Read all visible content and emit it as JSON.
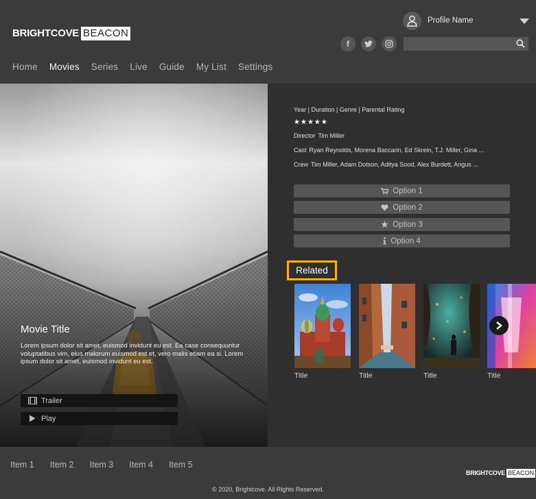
{
  "brand": {
    "name_bold": "BRIGHTCOVE",
    "name_box": "BEACON"
  },
  "profile": {
    "name": "Profile Name"
  },
  "social": [
    {
      "icon": "facebook-icon",
      "glyph": "f"
    },
    {
      "icon": "twitter-icon",
      "glyph": "t"
    },
    {
      "icon": "instagram-icon",
      "glyph": "◎"
    }
  ],
  "search": {
    "placeholder": ""
  },
  "nav": [
    {
      "label": "Home",
      "active": false
    },
    {
      "label": "Movies",
      "active": true
    },
    {
      "label": "Series",
      "active": false
    },
    {
      "label": "Live",
      "active": false
    },
    {
      "label": "Guide",
      "active": false
    },
    {
      "label": "My List",
      "active": false
    },
    {
      "label": "Settings",
      "active": false
    }
  ],
  "hero": {
    "title": "Movie Title",
    "description": "Lorem ipsum dolor sit amet, euismod invidunt eu est. Ea case consequuntur voluptatibus vim, eius malorum euismod est et, vero malis etiam ea si. Lorem ipsum dolor sit amet, euismod invidunt eu est.",
    "trailer_label": "Trailer",
    "play_label": "Play"
  },
  "details": {
    "meta": "Year | Duration | Genre | Parental Rating",
    "rating_stars": 5,
    "director_key": "Director",
    "director": "Tim Miller",
    "cast_key": "Cast",
    "cast": "Ryan Reynolds, Morena Baccarin, Ed Skrein, T.J. Miller, Gina ...",
    "crew_key": "Crew",
    "crew": "Tim Miller, Adam Dotson, Aditya Sood, Alex Burdett, Angus ..."
  },
  "options": [
    {
      "label": "Option 1",
      "icon": "cart-icon"
    },
    {
      "label": "Option 2",
      "icon": "heart-icon"
    },
    {
      "label": "Option 3",
      "icon": "star-icon"
    },
    {
      "label": "Option 4",
      "icon": "info-icon"
    }
  ],
  "related": {
    "heading": "Related",
    "items": [
      {
        "title": "Title"
      },
      {
        "title": "Title"
      },
      {
        "title": "Title"
      },
      {
        "title": "Title"
      }
    ]
  },
  "footer": {
    "items": [
      "Item 1",
      "Item 2",
      "Item 3",
      "Item 4",
      "Item 5"
    ],
    "copyright": "© 2020, Brightcove. All Rights Reserved."
  },
  "colors": {
    "accent_highlight": "#f5b400",
    "background": "#2f2f2f",
    "header": "#3b3b3b"
  }
}
